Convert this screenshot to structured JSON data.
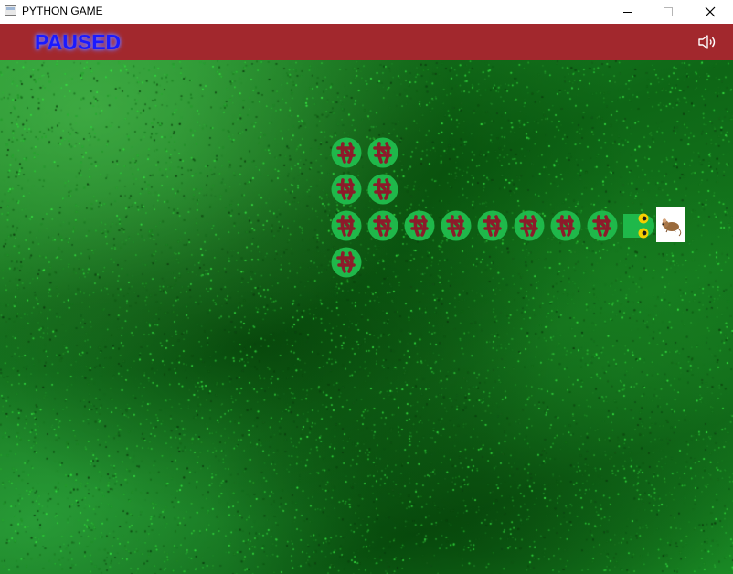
{
  "window": {
    "title": "PYTHON GAME",
    "icon": "app-window-icon",
    "controls": [
      "minimize-icon",
      "maximize-icon",
      "close-icon"
    ]
  },
  "header": {
    "status": "PAUSED",
    "status_color": "#1a1aff",
    "bar_color": "#a2282d",
    "sound_icon": "speaker-icon"
  },
  "game": {
    "background": "grass",
    "grid_cell": 40,
    "snake": {
      "body_color": "#1fb84a",
      "pattern_color": "#8c1b2a",
      "head_eye_color": "#f5d000",
      "direction": "right",
      "head": [
        17,
        4
      ],
      "body": [
        [
          16,
          4
        ],
        [
          15,
          4
        ],
        [
          14,
          4
        ],
        [
          13,
          4
        ],
        [
          12,
          4
        ],
        [
          11,
          4
        ],
        [
          10,
          4
        ],
        [
          9,
          4
        ],
        [
          9,
          3
        ],
        [
          9,
          2
        ],
        [
          10,
          2
        ],
        [
          10,
          3
        ],
        [
          9,
          5
        ]
      ]
    },
    "food": {
      "kind": "mouse",
      "cell": [
        18,
        4
      ]
    }
  }
}
